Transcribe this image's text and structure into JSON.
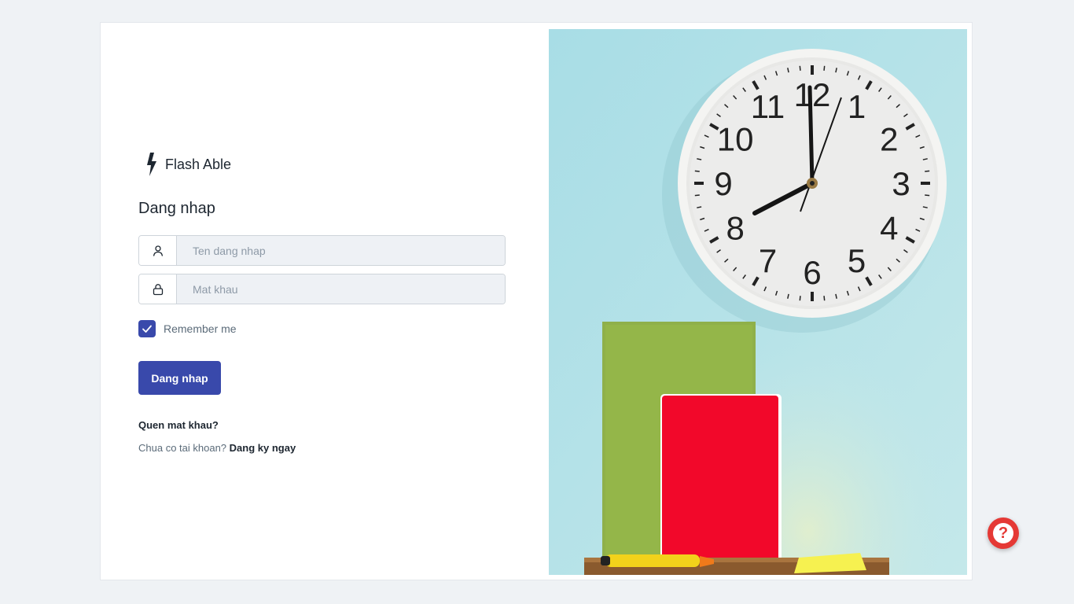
{
  "brand": {
    "name": "Flash Able",
    "icon": "lightning-bolt-icon"
  },
  "login": {
    "title": "Dang nhap",
    "username_placeholder": "Ten dang nhap",
    "username_value": "",
    "password_placeholder": "Mat khau",
    "password_value": "",
    "remember_label": "Remember me",
    "remember_checked": true,
    "submit_label": "Dang nhap",
    "forgot_label": "Quen mat khau?",
    "no_account_text": "Chua co tai khoan?",
    "signup_label": "Dang ky ngay"
  },
  "icons": {
    "username": "user-icon",
    "password": "lock-icon",
    "remember": "checkmark-icon",
    "help": "question-icon"
  },
  "help": {
    "symbol": "?"
  },
  "colors": {
    "primary": "#3949ab",
    "help": "#e53935",
    "background": "#eff2f5",
    "input_bg": "#eef1f5"
  }
}
